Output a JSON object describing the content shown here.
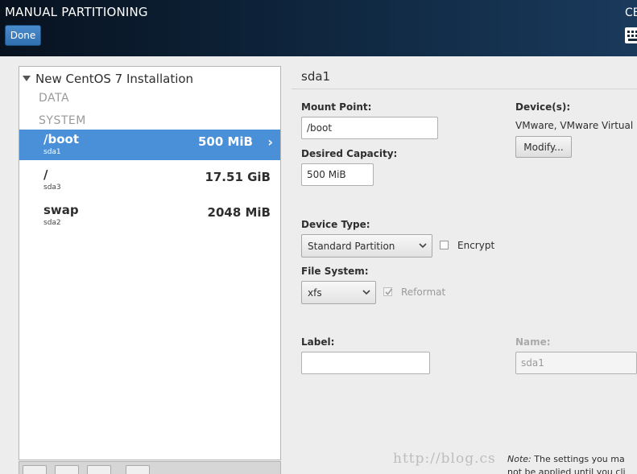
{
  "header": {
    "title": "MANUAL PARTITIONING",
    "done_label": "Done",
    "right_title_fragment": "CE"
  },
  "left_panel": {
    "installation_title": "New CentOS 7 Installation",
    "sections": [
      "DATA",
      "SYSTEM"
    ],
    "mount_points": [
      {
        "mount": "/boot",
        "device": "sda1",
        "size": "500 MiB",
        "selected": true
      },
      {
        "mount": "/",
        "device": "sda3",
        "size": "17.51 GiB",
        "selected": false
      },
      {
        "mount": "swap",
        "device": "sda2",
        "size": "2048 MiB",
        "selected": false
      }
    ]
  },
  "details": {
    "title": "sda1",
    "mount_point_label": "Mount Point:",
    "mount_point_value": "/boot",
    "desired_capacity_label": "Desired Capacity:",
    "desired_capacity_value": "500 MiB",
    "devices_label": "Device(s):",
    "devices_value": "VMware, VMware Virtual",
    "modify_label": "Modify...",
    "device_type_label": "Device Type:",
    "device_type_value": "Standard Partition",
    "encrypt_label": "Encrypt",
    "encrypt_checked": false,
    "file_system_label": "File System:",
    "file_system_value": "xfs",
    "reformat_label": "Reformat",
    "reformat_checked": true,
    "label_label": "Label:",
    "label_value": "",
    "name_label": "Name:",
    "name_value": "sda1"
  },
  "footer": {
    "note_prefix": "Note:",
    "note_line1": " The settings you ma",
    "note_line2": "not be applied until you cli",
    "watermark": "http://blog.cs"
  }
}
